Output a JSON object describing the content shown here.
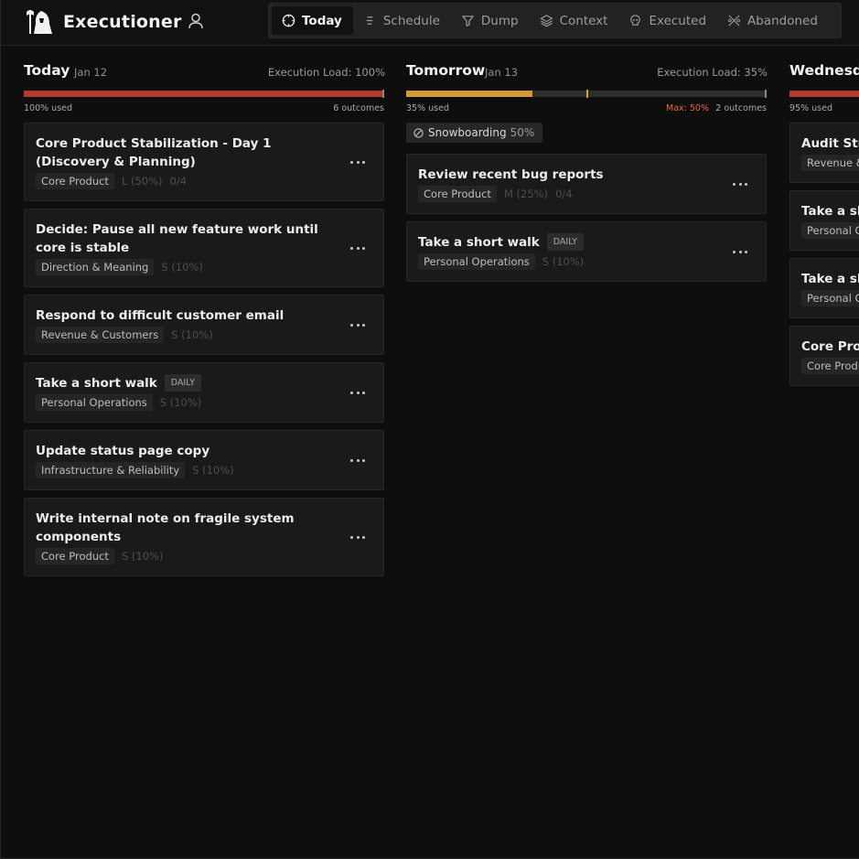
{
  "app": {
    "name": "Executioner"
  },
  "nav": {
    "tabs": [
      {
        "label": "Today",
        "icon": "crosshair-icon",
        "active": true
      },
      {
        "label": "Schedule",
        "icon": "sort-lines-icon",
        "active": false
      },
      {
        "label": "Dump",
        "icon": "funnel-icon",
        "active": false
      },
      {
        "label": "Context",
        "icon": "layers-icon",
        "active": false
      },
      {
        "label": "Executed",
        "icon": "skull-icon",
        "active": false
      },
      {
        "label": "Abandoned",
        "icon": "scatter-x-icon",
        "active": false
      }
    ]
  },
  "columns": [
    {
      "title": "Today",
      "date": "Jan 12",
      "load_label": "Execution Load: 100%",
      "used_label": "100% used",
      "outcomes_label": "6 outcomes",
      "used_fraction": 1.0,
      "bar_color": "#b03a2e",
      "cards": [
        {
          "title": "Core Product Stabilization - Day 1 (Discovery & Planning)",
          "area": "Core Product",
          "size": "L (50%)",
          "progress": "0/4",
          "daily": ""
        },
        {
          "title": "Decide: Pause all new feature work until core is stable",
          "area": "Direction & Meaning",
          "size": "S (10%)",
          "progress": "",
          "daily": ""
        },
        {
          "title": "Respond to difficult customer email",
          "area": "Revenue & Customers",
          "size": "S (10%)",
          "progress": "",
          "daily": ""
        },
        {
          "title": "Take a short walk",
          "area": "Personal Operations",
          "size": "S (10%)",
          "progress": "",
          "daily": "DAILY"
        },
        {
          "title": "Update status page copy",
          "area": "Infrastructure & Reliability",
          "size": "S (10%)",
          "progress": "",
          "daily": ""
        },
        {
          "title": "Write internal note on fragile system components",
          "area": "Core Product",
          "size": "S (10%)",
          "progress": "",
          "daily": ""
        }
      ]
    },
    {
      "title": "Tomorrow",
      "date": "Jan 13",
      "load_label": "Execution Load: 35%",
      "used_label": "35% used",
      "max_label": "Max: 50%",
      "outcomes_label": "2 outcomes",
      "used_fraction": 0.35,
      "max_fraction": 0.5,
      "bar_color": "#d49a3a",
      "tag": {
        "label": "Snowboarding",
        "pct": "50%",
        "icon": "slash-circle-icon"
      },
      "cards": [
        {
          "title": "Review recent bug reports",
          "area": "Core Product",
          "size": "M (25%)",
          "progress": "0/4",
          "daily": ""
        },
        {
          "title": "Take a short walk",
          "area": "Personal Operations",
          "size": "S (10%)",
          "progress": "",
          "daily": "DAILY"
        }
      ]
    },
    {
      "title": "Wednesda",
      "date": "",
      "used_label": "95% used",
      "used_fraction": 0.95,
      "bar_color": "#b03a2e",
      "cards": [
        {
          "title": "Audit Strip",
          "area": "Revenue &",
          "size": "",
          "progress": "",
          "daily": ""
        },
        {
          "title": "Take a sho",
          "area": "Personal O",
          "size": "",
          "progress": "",
          "daily": ""
        },
        {
          "title": "Take a sho",
          "area": "Personal O",
          "size": "",
          "progress": "",
          "daily": ""
        },
        {
          "title": "Core Prod Refactorin",
          "area": "Core Produ",
          "size": "",
          "progress": "",
          "daily": ""
        }
      ]
    }
  ]
}
